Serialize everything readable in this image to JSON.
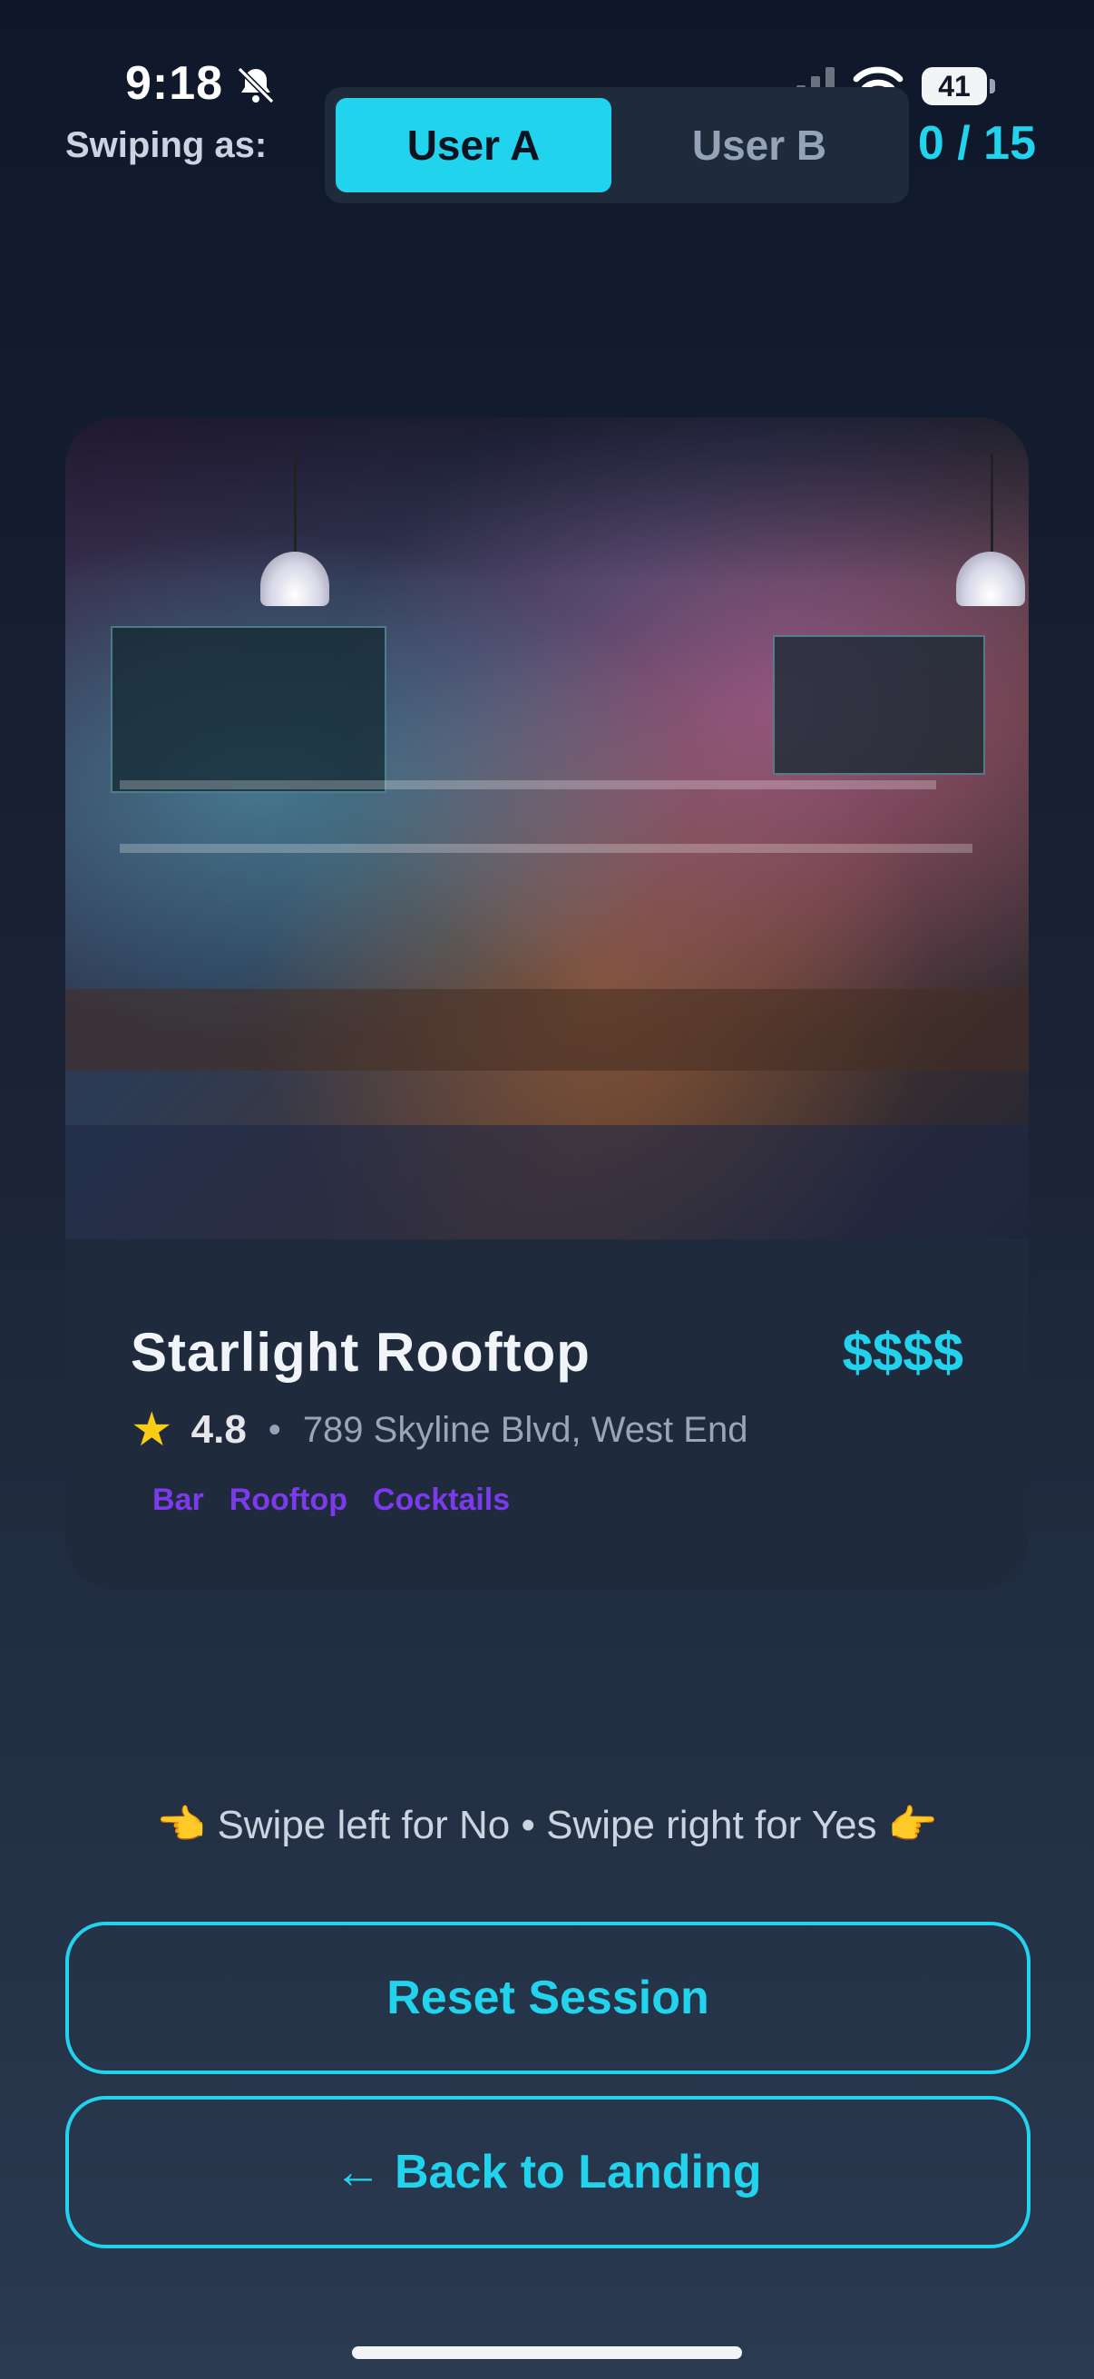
{
  "status_bar": {
    "time": "9:18",
    "battery": "41",
    "icons": [
      "bell-slash-icon",
      "signal-icon",
      "wifi-icon",
      "battery-icon"
    ]
  },
  "header": {
    "swiping_label": "Swiping as:",
    "user_a": "User A",
    "user_b": "User B",
    "selected_user": "User A",
    "counter": "0 / 15"
  },
  "card": {
    "name": "Starlight Rooftop",
    "price": "$$$$",
    "rating": "4.8",
    "separator": "•",
    "address": "789 Skyline Blvd, West End",
    "tags": [
      "Bar",
      "Rooftop",
      "Cocktails"
    ]
  },
  "hint": {
    "left_hand": "👈",
    "text": "Swipe left for No • Swipe right for Yes",
    "right_hand": "👉"
  },
  "buttons": {
    "reset": "Reset Session",
    "back": "← Back to Landing"
  },
  "colors": {
    "accent": "#22d3ee",
    "tag": "#7c3aed",
    "background_top": "#0f172a",
    "card": "#1f2a3c"
  }
}
